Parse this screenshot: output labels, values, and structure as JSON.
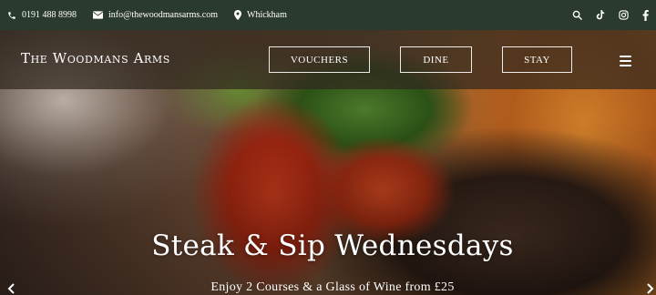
{
  "topbar": {
    "phone": "0191 488 8998",
    "email": "info@thewoodmansarms.com",
    "location": "Whickham",
    "icons": [
      "phone-icon",
      "envelope-icon",
      "map-pin-icon",
      "search-icon",
      "tiktok-icon",
      "instagram-icon",
      "facebook-icon"
    ]
  },
  "header": {
    "brand": "The Woodmans Arms",
    "nav": {
      "vouchers": "VOUCHERS",
      "dine": "DINE",
      "stay": "STAY"
    },
    "menu_icon": "hamburger-menu-icon"
  },
  "hero": {
    "title": "Steak & Sip Wednesdays",
    "subtitle": "Enjoy 2 Courses & a Glass of Wine from £25",
    "prev_icon": "chevron-left-icon",
    "next_icon": "chevron-right-icon"
  },
  "colors": {
    "topbar_bg": "#2b3a2e",
    "nav_overlay": "#30281e",
    "text": "#ffffff"
  }
}
